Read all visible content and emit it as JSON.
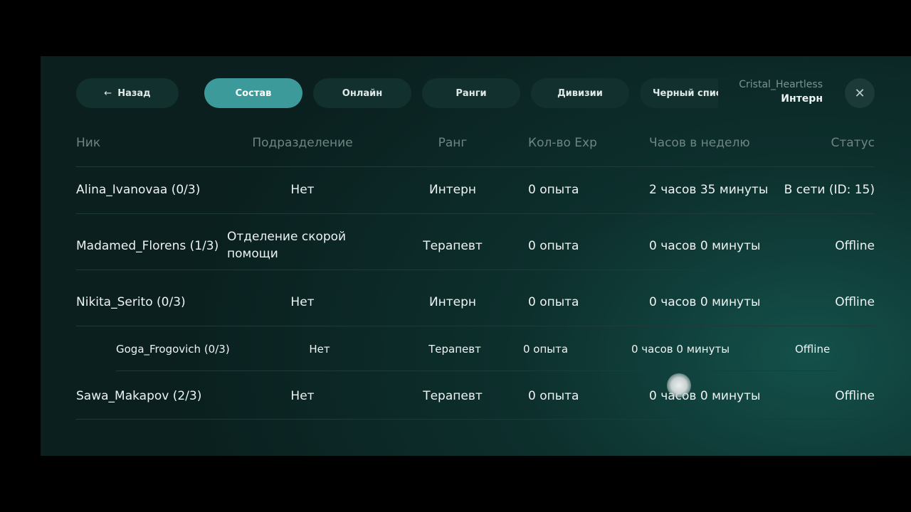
{
  "nav": {
    "back": "Назад",
    "tabs": [
      "Состав",
      "Онлайн",
      "Ранги",
      "Дивизии",
      "Черный спис"
    ]
  },
  "user": {
    "name": "Cristal_Heartless",
    "rank": "Интерн"
  },
  "table": {
    "headers": [
      "Ник",
      "Подразделение",
      "Ранг",
      "Кол-во Exp",
      "Часов в неделю",
      "Статус"
    ],
    "rows": [
      [
        "Alina_Ivanovaa (0/3)",
        "Нет",
        "Интерн",
        "0 опыта",
        "2 часов 35 минуты",
        "В сети (ID: 15)"
      ],
      [
        "Madamed_Florens (1/3)",
        "Отделение скорой помощи",
        "Терапевт",
        "0 опыта",
        "0 часов 0 минуты",
        "Offline"
      ],
      [
        "Nikita_Serito (0/3)",
        "Нет",
        "Интерн",
        "0 опыта",
        "0 часов 0 минуты",
        "Offline"
      ],
      [
        "Goga_Frogovich (0/3)",
        "Нет",
        "Терапевт",
        "0 опыта",
        "0 часов 0 минуты",
        "Offline"
      ],
      [
        "Sawa_Makapov (2/3)",
        "Нет",
        "Терапевт",
        "0 опыта",
        "0 часов 0 минуты",
        "Offline"
      ]
    ]
  }
}
